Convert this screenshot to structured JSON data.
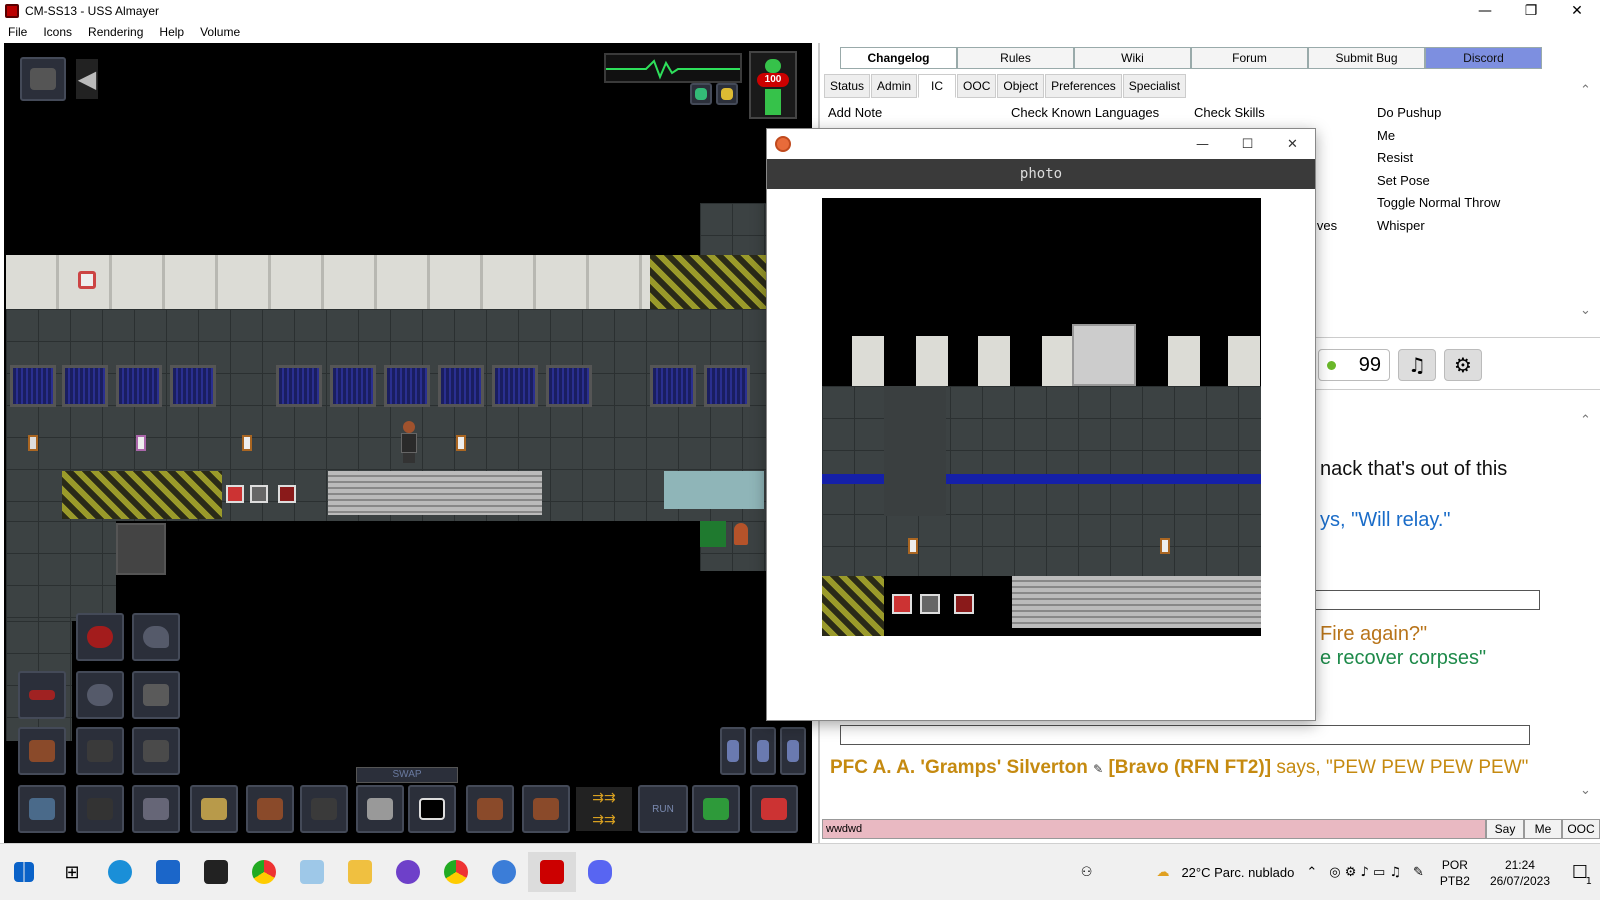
{
  "window": {
    "title": "CM-SS13 - USS Almayer",
    "controls": [
      "—",
      "❐",
      "✕"
    ]
  },
  "menu": [
    "File",
    "Icons",
    "Rendering",
    "Help",
    "Volume"
  ],
  "hud": {
    "health": "100",
    "swap_label": "SWAP",
    "run_label": "RUN"
  },
  "toptabs": [
    {
      "label": "Changelog",
      "active": true
    },
    {
      "label": "Rules"
    },
    {
      "label": "Wiki"
    },
    {
      "label": "Forum"
    },
    {
      "label": "Submit Bug"
    },
    {
      "label": "Discord"
    }
  ],
  "subtabs": [
    "Status",
    "Admin",
    "IC",
    "OOC",
    "Object",
    "Preferences",
    "Specialist"
  ],
  "verbs": {
    "col1": [
      "Add Note"
    ],
    "col2": [
      "Check Known Languages"
    ],
    "col3": [
      "Check Skills",
      "",
      "",
      "",
      "",
      "ives"
    ],
    "col4": [
      "Do Pushup",
      "Me",
      "Resist",
      "Set Pose",
      "Toggle Normal Throw",
      "Whisper"
    ]
  },
  "players_online": "99",
  "chat": {
    "line1": "nack that's out of this",
    "line2": "ys, \"Will relay.\"",
    "line3": "Fire again?\"",
    "line4": "e recover corpses\"",
    "final_name": "PFC A. A. 'Gramps' Silverton",
    "final_squad": "[Bravo (RFN FT2)]",
    "final_says": "says, \"PEW  PEW PEW PEW\""
  },
  "command": {
    "value": "wwdwd",
    "buttons": [
      "Say",
      "Me",
      "OOC"
    ]
  },
  "photo_window": {
    "header": "photo",
    "controls": [
      "—",
      "☐",
      "✕"
    ]
  },
  "taskbar": {
    "weather": "22°C  Parc. nublado",
    "lang_top": "POR",
    "lang_bottom": "PTB2",
    "time": "21:24",
    "date": "26/07/2023",
    "notifications": "1"
  }
}
